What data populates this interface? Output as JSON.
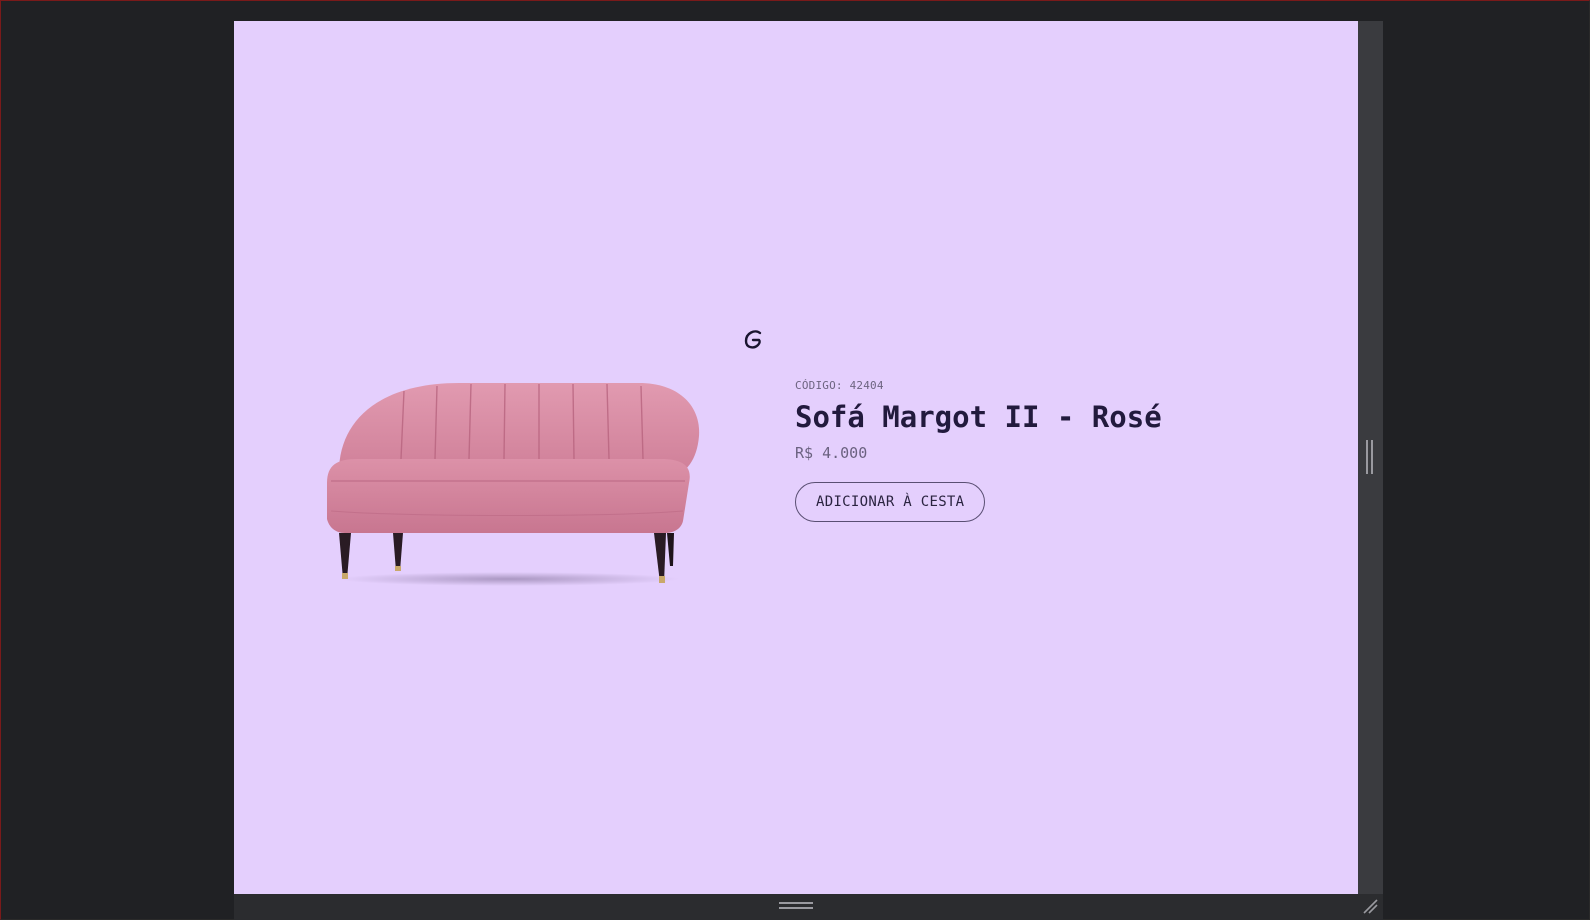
{
  "product": {
    "code_label": "CÓDIGO:",
    "code_value": "42404",
    "name": "Sofá Margot II - Rosé",
    "price": "R$ 4.000",
    "add_to_cart_label": "ADICIONAR À CESTA",
    "image": "pink-sofa-image"
  },
  "brand": {
    "logo": "g-logo-icon"
  },
  "colors": {
    "page_background": "#e4cffd",
    "frame_background": "#202124",
    "title_text": "#221a3d",
    "muted_text": "#6b6280",
    "sofa_fabric": "#d8879f"
  }
}
